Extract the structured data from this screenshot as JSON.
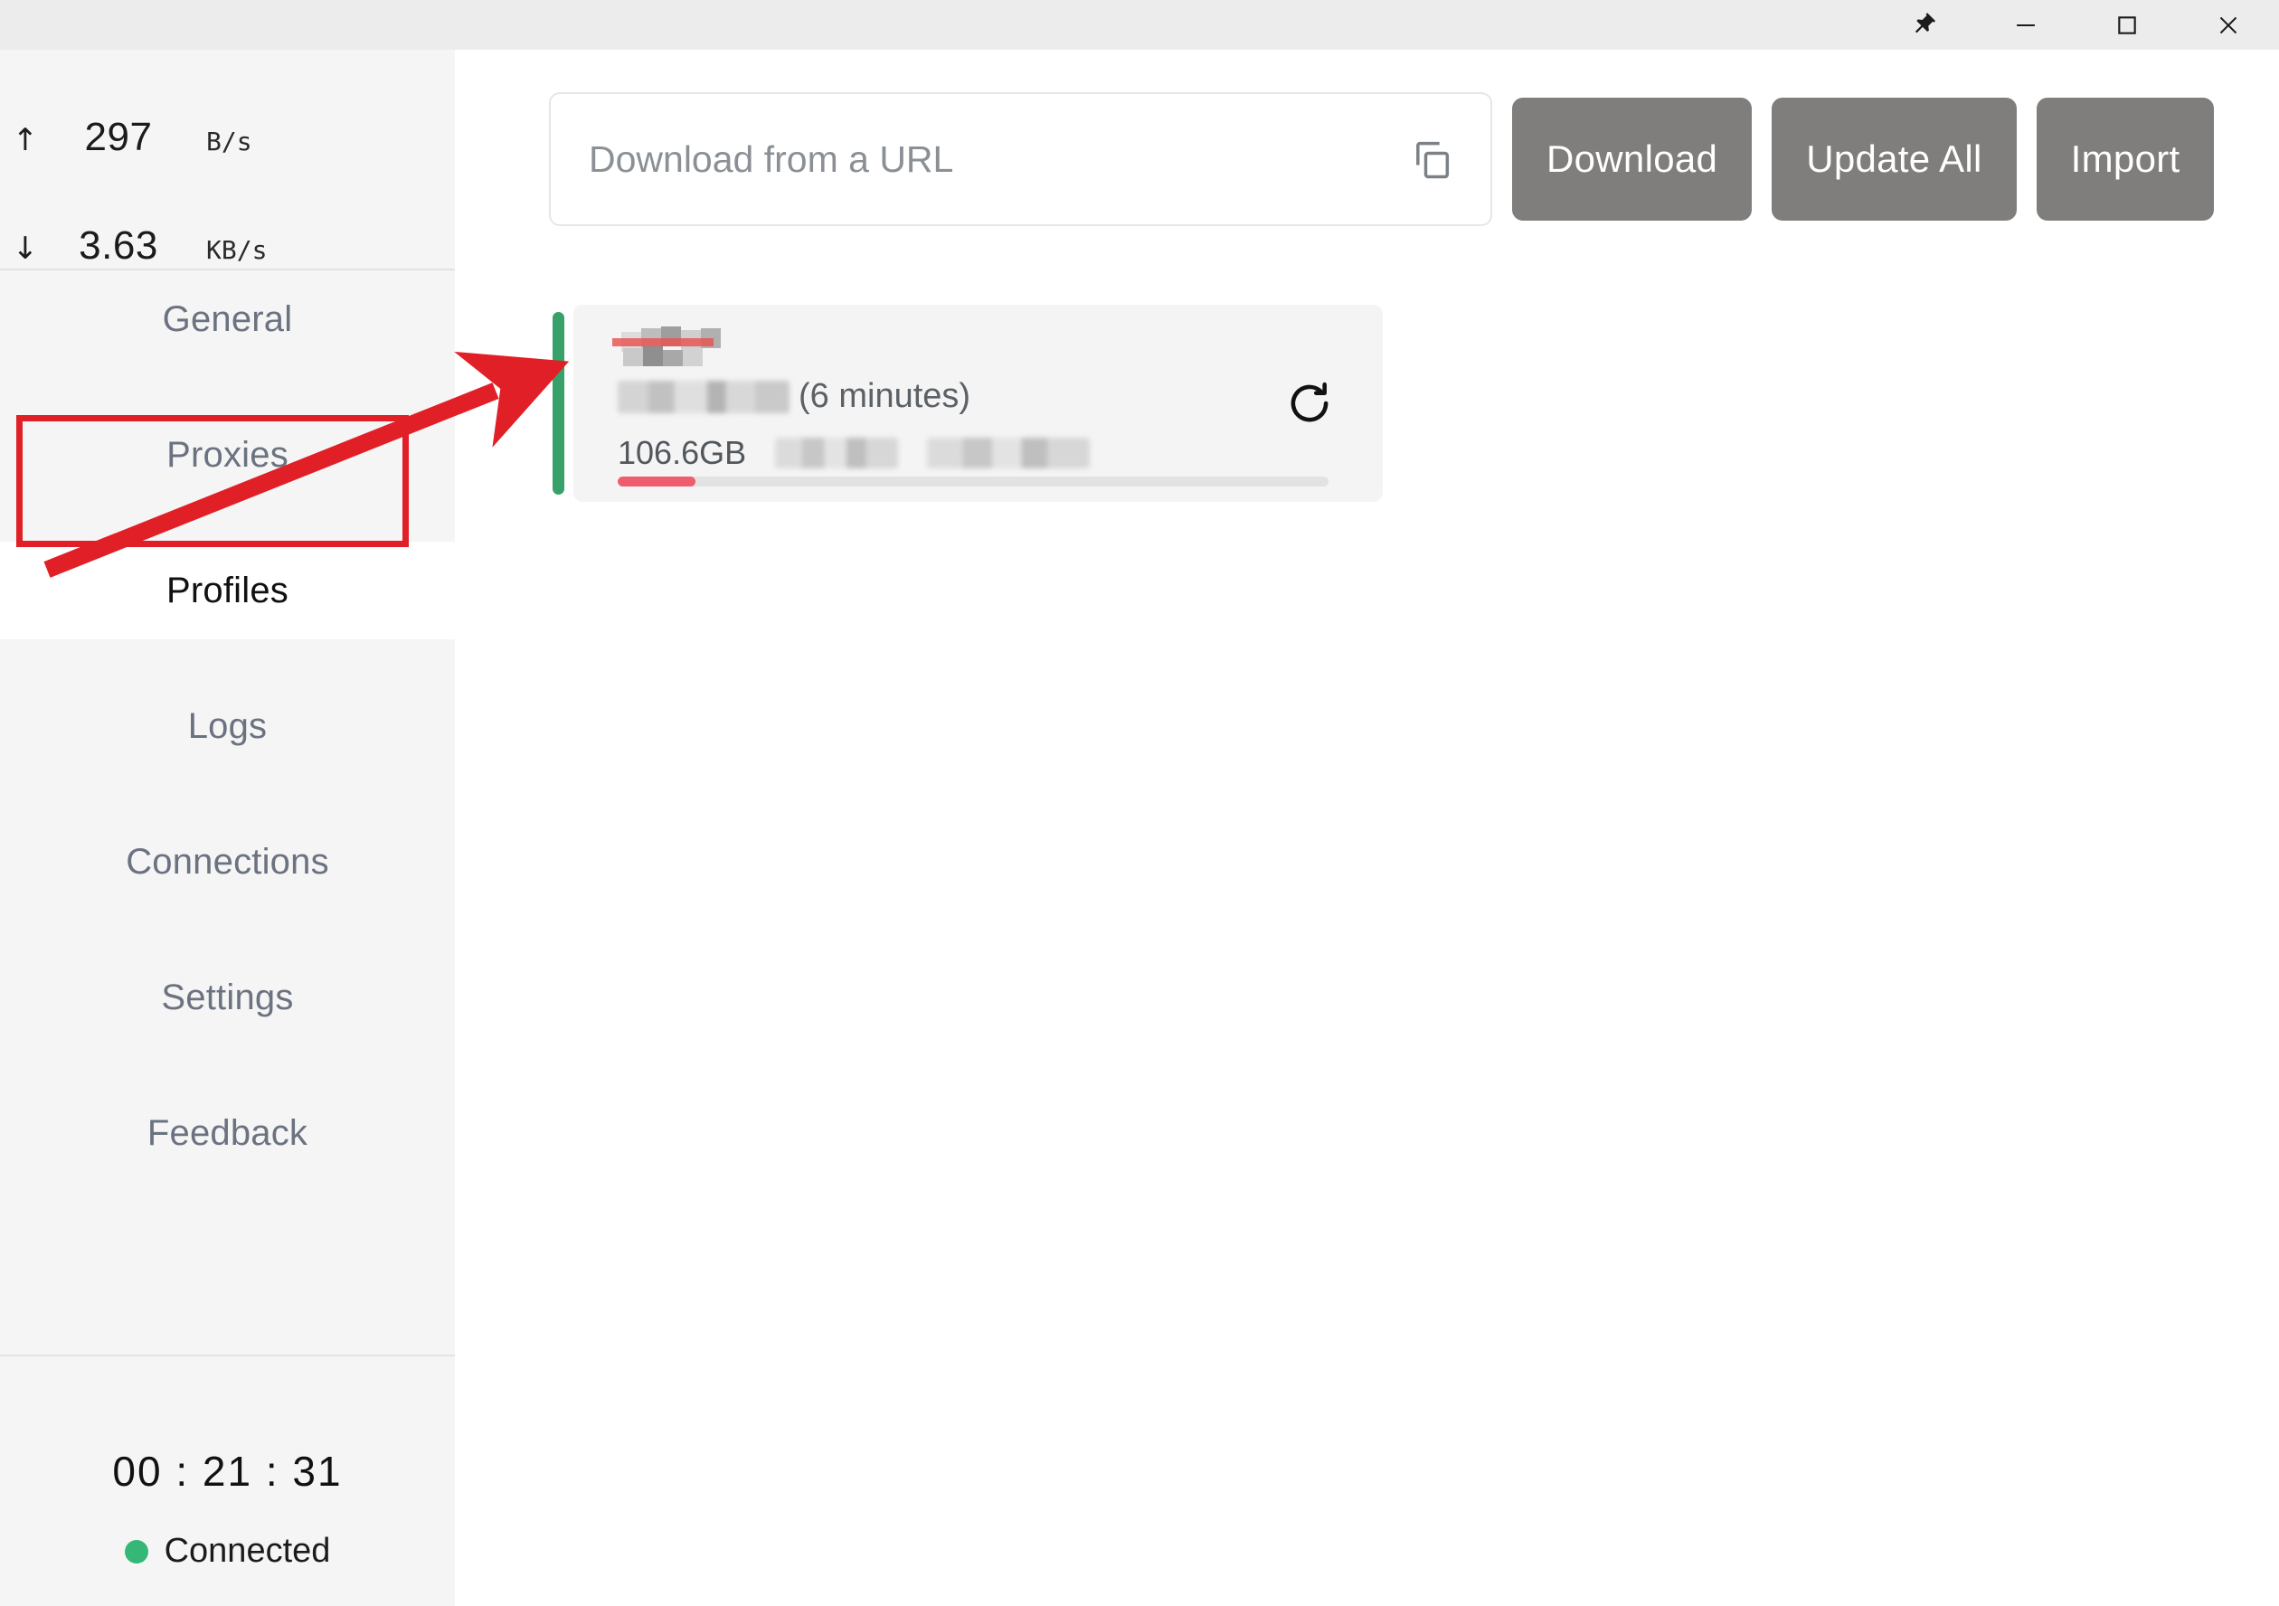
{
  "window": {
    "controls": [
      {
        "name": "pin",
        "label": "Pin",
        "glyph": "pin-icon"
      },
      {
        "name": "minimize",
        "label": "Minimize",
        "glyph": "minimize-icon"
      },
      {
        "name": "maximize",
        "label": "Maximize",
        "glyph": "maximize-icon"
      },
      {
        "name": "close",
        "label": "Close",
        "glyph": "close-icon"
      }
    ]
  },
  "sidebar": {
    "speed": {
      "upload": {
        "arrow": "↑",
        "value": "297",
        "unit": "B/s"
      },
      "download": {
        "arrow": "↓",
        "value": "3.63",
        "unit": "KB/s"
      }
    },
    "nav": [
      {
        "label": "General",
        "active": false
      },
      {
        "label": "Proxies",
        "active": false
      },
      {
        "label": "Profiles",
        "active": true
      },
      {
        "label": "Logs",
        "active": false
      },
      {
        "label": "Connections",
        "active": false
      },
      {
        "label": "Settings",
        "active": false
      },
      {
        "label": "Feedback",
        "active": false
      }
    ],
    "status": {
      "timer": "00 : 21 : 31",
      "connection_label": "Connected",
      "connection_color": "#35b877"
    }
  },
  "toolbar": {
    "url_placeholder": "Download from a URL",
    "url_value": "",
    "copy_icon": "copy-icon",
    "buttons": [
      {
        "label": "Download"
      },
      {
        "label": "Update All"
      },
      {
        "label": "Import"
      }
    ]
  },
  "profiles": [
    {
      "name_redacted": true,
      "status_color": "#38a169",
      "update_interval": "(6 minutes)",
      "traffic_used": "106.6GB",
      "progress_percent": 11,
      "progress_color": "#ef5d6c",
      "refresh_icon": "refresh-icon"
    }
  ],
  "annotations": {
    "arrow_color": "#e01f26",
    "highlight_color": "#e01f26",
    "highlight_target": "Profiles"
  }
}
